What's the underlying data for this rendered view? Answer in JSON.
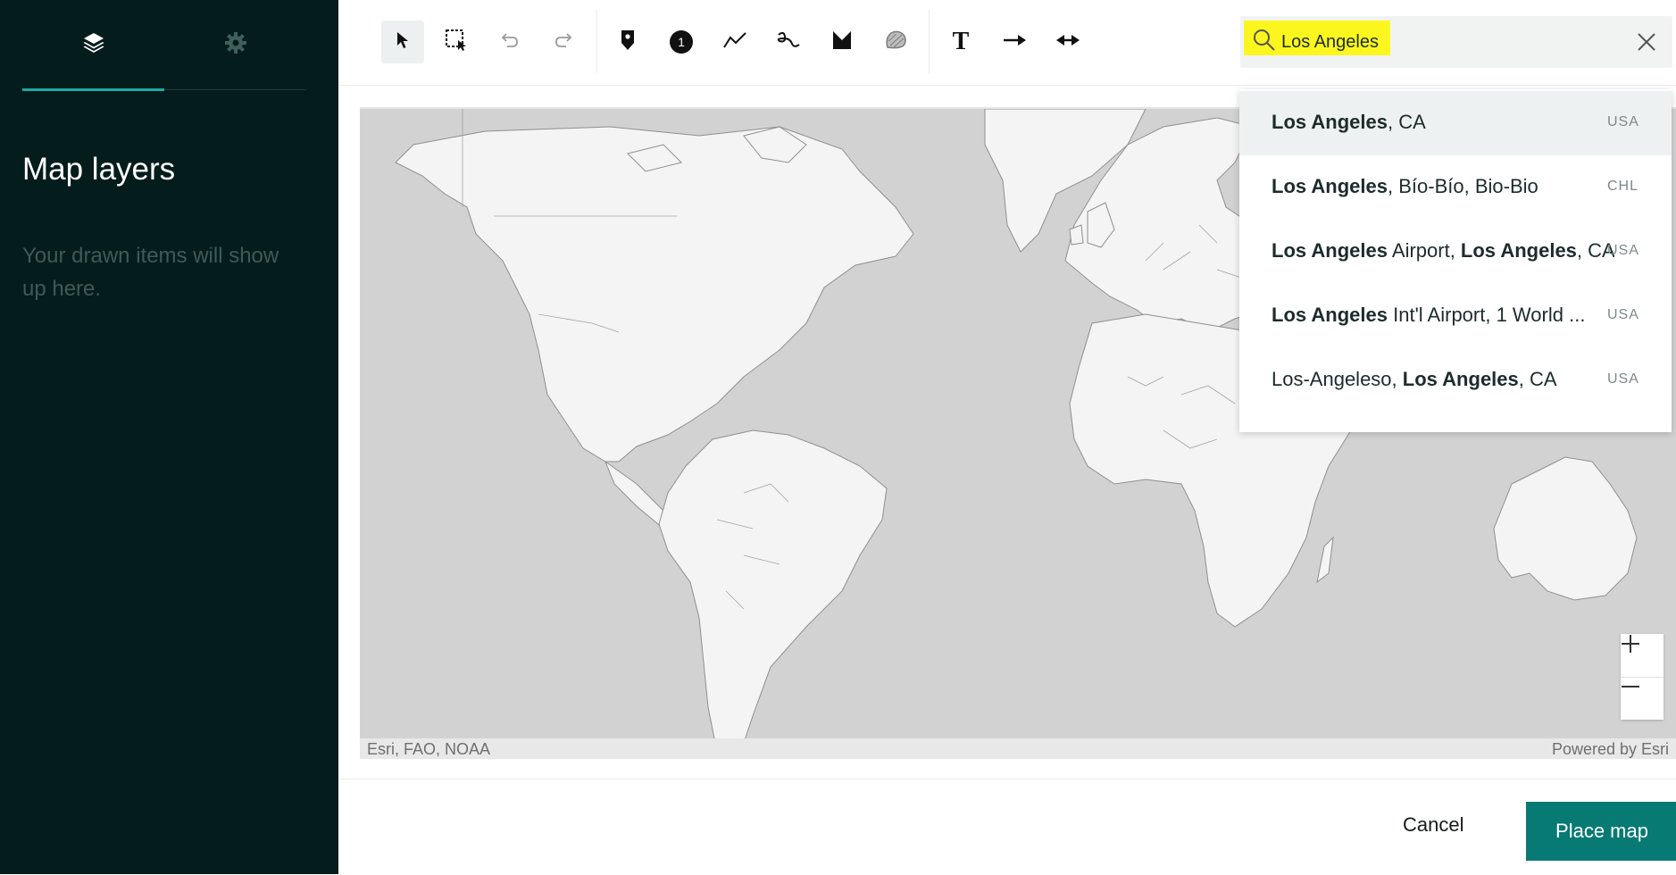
{
  "sidebar": {
    "tabs": [
      {
        "icon": "layers-icon",
        "active": true
      },
      {
        "icon": "gear-icon",
        "active": false
      }
    ],
    "title": "Map layers",
    "empty_message": "Your drawn items will show up here."
  },
  "toolbar": {
    "tools": [
      "select-tool",
      "marquee-select-tool",
      "undo",
      "redo",
      "pin-marker",
      "numbered-marker",
      "polyline",
      "freehand",
      "polygon",
      "freehand-polygon",
      "text",
      "arrow",
      "double-arrow"
    ],
    "numbered_marker_label": "1",
    "text_tool_label": "T"
  },
  "search": {
    "value": "Los Angeles",
    "highlight_color": "#fbf71e",
    "suggestions": [
      {
        "bold": "Los Angeles",
        "rest": ", CA",
        "country": "USA"
      },
      {
        "bold": "Los Angeles",
        "rest": ", Bío-Bío, Bio-Bio",
        "country": "CHL"
      },
      {
        "bold": "Los Angeles",
        "rest": " Airport, ",
        "bold2": "Los Angeles",
        "rest2": ", CA",
        "country": "USA"
      },
      {
        "bold": "Los Angeles",
        "rest": " Int'l Airport, 1 World ...",
        "country": "USA"
      },
      {
        "pre": "Los-Angeleso, ",
        "bold": "Los Angeles",
        "rest": ", CA",
        "country": "USA"
      }
    ]
  },
  "map": {
    "attribution_left": "Esri, FAO, NOAA",
    "attribution_right": "Powered by Esri",
    "zoom_in": "+",
    "zoom_out": "—"
  },
  "footer": {
    "cancel_label": "Cancel",
    "place_label": "Place map"
  },
  "colors": {
    "sidebar_bg": "#051c1c",
    "accent": "#1fa8a3",
    "primary_button": "#087a74",
    "ocean": "#d2d2d2",
    "land": "#f4f4f4"
  }
}
